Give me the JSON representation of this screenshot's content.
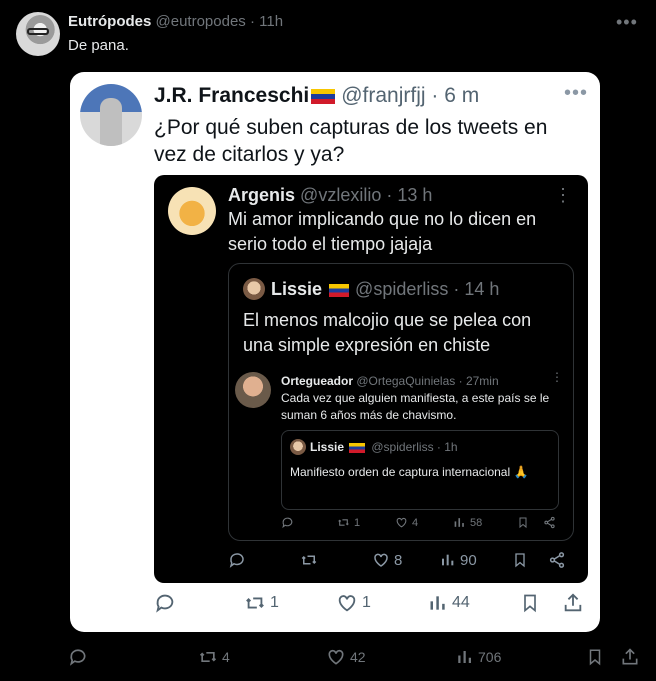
{
  "tweet": {
    "author_name": "Eutrópodes",
    "handle": "@eutropodes",
    "time": "· 11h",
    "text": "De pana.",
    "more_icon": "more-horizontal-icon",
    "actions": {
      "replies": "",
      "retweets": "4",
      "likes": "42",
      "views": "706"
    }
  },
  "screenshot": {
    "author_name": "J.R. Franceschi",
    "handle": "@franjrfjj",
    "time": "· 6 m",
    "text": "¿Por qué suben capturas de los tweets en vez de citarlos y ya?",
    "actions": {
      "replies": "",
      "retweets": "1",
      "likes": "1",
      "views": "44"
    },
    "quote": {
      "author_name": "Argenis",
      "handle": "@vzlexilio",
      "time": "· 13 h",
      "text": "Mi amor implicando que no lo dicen en serio todo el tiempo jajaja",
      "actions": {
        "replies": "",
        "retweets": "",
        "likes": "8",
        "views": "90"
      },
      "quote": {
        "author_name": "Lissie",
        "handle": "@spiderliss",
        "time": "· 14 h",
        "text": "El menos malcojio que se pelea con una simple expresión en chiste",
        "reply": {
          "author_name": "Orteguead​or",
          "handle": "@OrtegaQuinielas",
          "time": "· 27min",
          "text": "Cada vez que alguien manifiesta, a este país se le suman 6 años más de chavismo.",
          "quote": {
            "author_name": "Lissie",
            "handle": "@spiderliss",
            "time": "· 1h",
            "text": "Manifiesto orden de captura internacional 🙏"
          },
          "actions": {
            "replies": "",
            "retweets": "1",
            "likes": "4",
            "views": "58"
          }
        }
      }
    }
  },
  "colors": {
    "bg": "#000000",
    "card": "#ffffff",
    "muted": "#71767b",
    "flag": [
      "#f7c600",
      "#1d3c9c",
      "#d11a2a"
    ]
  }
}
